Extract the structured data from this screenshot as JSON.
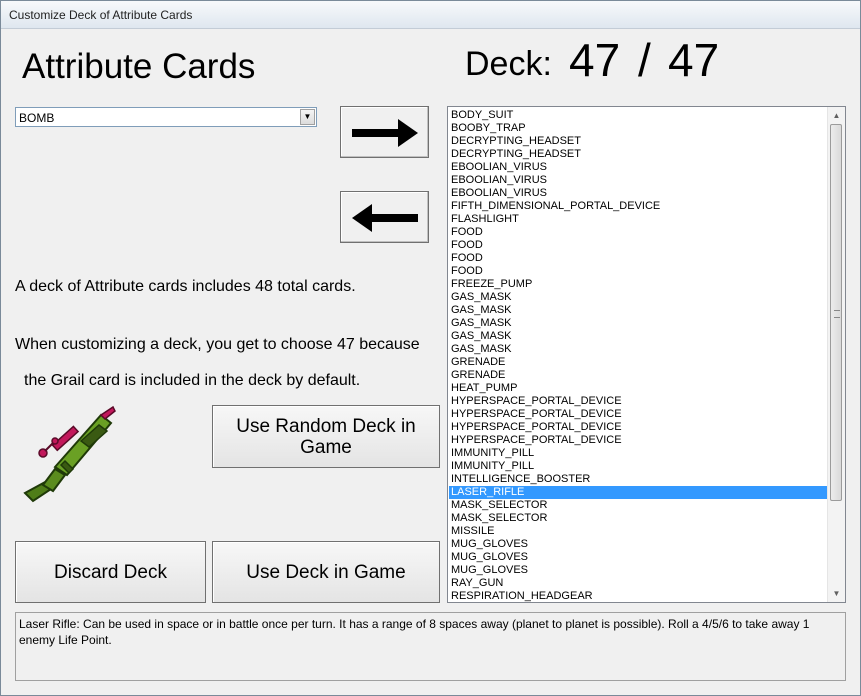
{
  "window": {
    "title": "Customize Deck of Attribute Cards"
  },
  "heading": "Attribute Cards",
  "deck": {
    "label": "Deck:",
    "count": "47",
    "separator": "/",
    "total": "47"
  },
  "card_select": {
    "value": "BOMB"
  },
  "buttons": {
    "add_icon": "right-arrow-icon",
    "remove_icon": "left-arrow-icon",
    "random_deck": "Use Random Deck in Game",
    "discard_deck": "Discard Deck",
    "use_deck": "Use Deck in Game"
  },
  "info": {
    "line1": "A deck of Attribute cards includes 48 total cards.",
    "line2": "When customizing a deck, you get to choose 47 because",
    "line3": "the Grail card is included in the deck by default."
  },
  "card_image": {
    "icon": "laser-rifle-icon"
  },
  "deck_list": {
    "items": [
      "BODY_SUIT",
      "BOOBY_TRAP",
      "DECRYPTING_HEADSET",
      "DECRYPTING_HEADSET",
      "EBOOLIAN_VIRUS",
      "EBOOLIAN_VIRUS",
      "EBOOLIAN_VIRUS",
      "FIFTH_DIMENSIONAL_PORTAL_DEVICE",
      "FLASHLIGHT",
      "FOOD",
      "FOOD",
      "FOOD",
      "FOOD",
      "FREEZE_PUMP",
      "GAS_MASK",
      "GAS_MASK",
      "GAS_MASK",
      "GAS_MASK",
      "GAS_MASK",
      "GRENADE",
      "GRENADE",
      "HEAT_PUMP",
      "HYPERSPACE_PORTAL_DEVICE",
      "HYPERSPACE_PORTAL_DEVICE",
      "HYPERSPACE_PORTAL_DEVICE",
      "HYPERSPACE_PORTAL_DEVICE",
      "IMMUNITY_PILL",
      "IMMUNITY_PILL",
      "INTELLIGENCE_BOOSTER",
      "LASER_RIFLE",
      "MASK_SELECTOR",
      "MASK_SELECTOR",
      "MISSILE",
      "MUG_GLOVES",
      "MUG_GLOVES",
      "MUG_GLOVES",
      "RAY_GUN",
      "RESPIRATION_HEADGEAR"
    ],
    "selected": "LASER_RIFLE"
  },
  "description": "Laser Rifle: Can be used in space or in battle once per turn. It has a range of 8 spaces away (planet to planet is possible). Roll a 4/5/6 to take away 1 enemy Life Point.",
  "colors": {
    "selection": "#3399ff",
    "rifle_body": "#5b8c1e",
    "rifle_accent": "#c2185b"
  }
}
